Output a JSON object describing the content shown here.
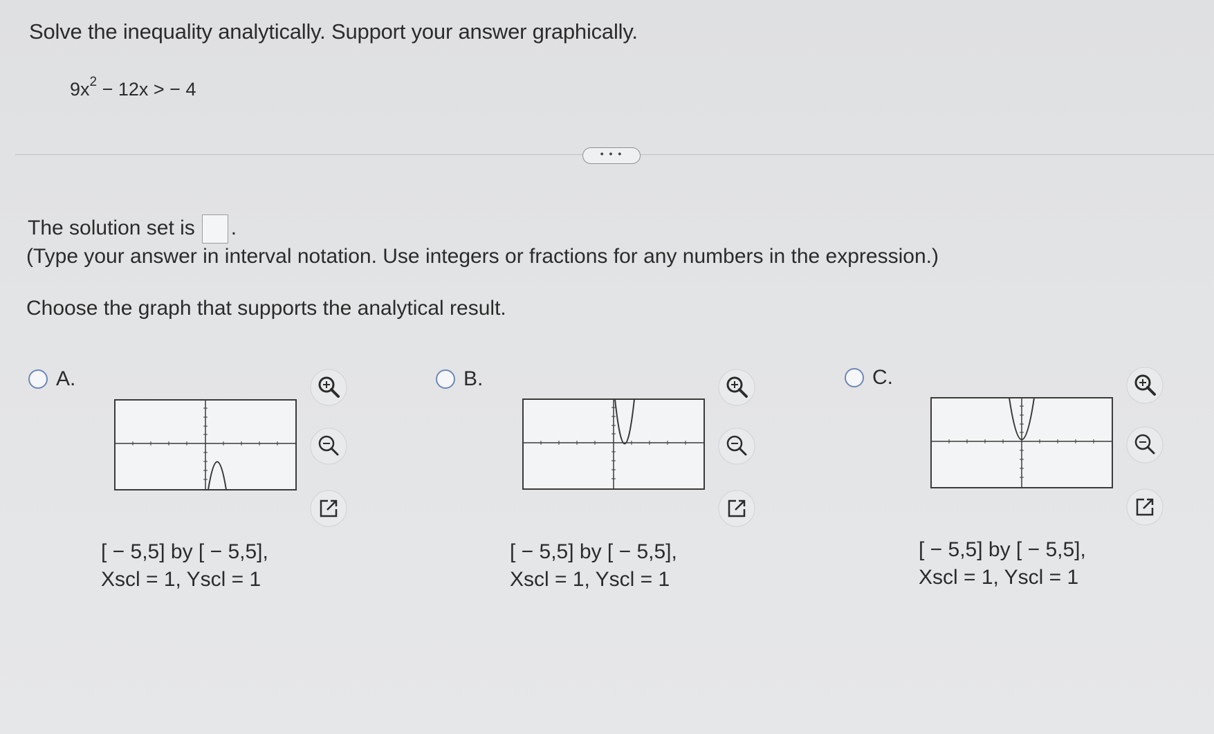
{
  "question": {
    "title": "Solve the inequality analytically. Support your answer graphically.",
    "equation_lhs_a": "9x",
    "equation_exp": "2",
    "equation_rest": " − 12x > − 4"
  },
  "more_button": "• • •",
  "solution": {
    "prefix": "The solution set is",
    "suffix": ".",
    "answer_value": "",
    "instruction": "(Type your answer in interval notation. Use integers or fractions for any numbers in the expression.)"
  },
  "choose_prompt": "Choose the graph that supports the analytical result.",
  "options": [
    {
      "label": "A.",
      "window_line1": "[ − 5,5] by [ − 5,5],",
      "window_line2": "Xscl = 1, Yscl = 1"
    },
    {
      "label": "B.",
      "window_line1": "[ − 5,5] by [ − 5,5],",
      "window_line2": "Xscl = 1, Yscl = 1"
    },
    {
      "label": "C.",
      "window_line1": "[ − 5,5] by [ − 5,5],",
      "window_line2": "Xscl = 1, Yscl = 1"
    }
  ],
  "icons": [
    "zoom-in-icon",
    "zoom-out-icon",
    "open-external-icon"
  ],
  "colors": {
    "radio": "#6f88b5",
    "text": "#2b2b2b",
    "graph_line": "#3a3a3a"
  }
}
